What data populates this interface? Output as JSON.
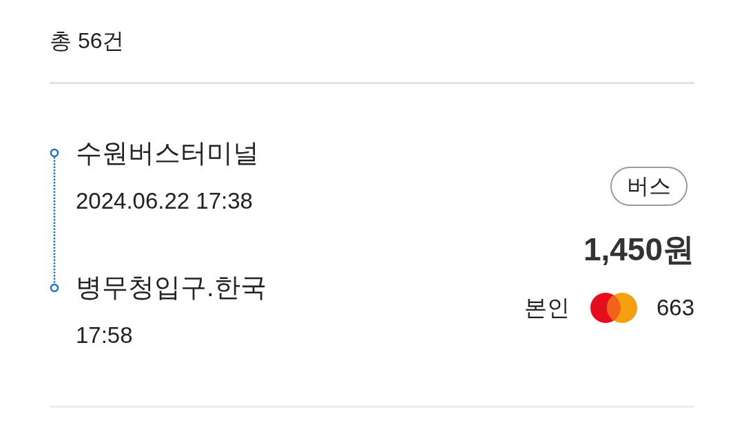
{
  "summary": {
    "total": "총 56건"
  },
  "trips": [
    {
      "origin": {
        "name": "수원버스터미널",
        "time": "2024.06.22 17:38"
      },
      "destination": {
        "name": "병무청입구.한국",
        "time": "17:58"
      },
      "badge": "버스",
      "fare": "1,450원",
      "payer": "본인",
      "card": {
        "kind": "mastercard",
        "number": "663"
      }
    }
  ]
}
